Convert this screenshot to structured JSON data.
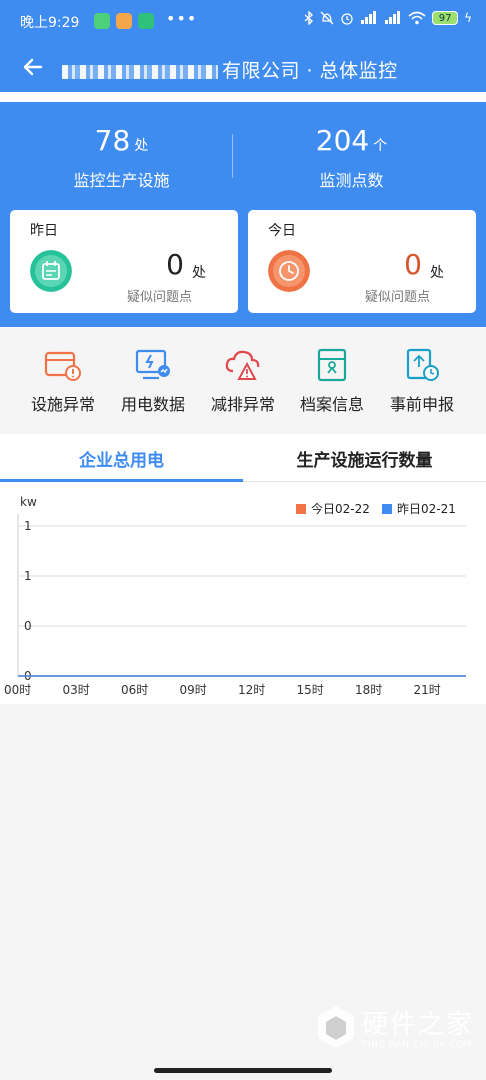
{
  "status_bar": {
    "time": "晚上9:29",
    "battery": "97"
  },
  "nav": {
    "title_blurred": "",
    "title_suffix": "有限公司 · 总体监控"
  },
  "summary": {
    "facilities": {
      "value": "78",
      "unit": "处",
      "label": "监控生产设施"
    },
    "points": {
      "value": "204",
      "unit": "个",
      "label": "监测点数"
    }
  },
  "yesterday": {
    "title": "昨日",
    "value": "0",
    "unit": "处",
    "label": "疑似问题点"
  },
  "today": {
    "title": "今日",
    "value": "0",
    "unit": "处",
    "label": "疑似问题点"
  },
  "quick_actions": [
    {
      "label": "设施异常",
      "icon": "facility-alert-icon"
    },
    {
      "label": "用电数据",
      "icon": "power-monitor-icon"
    },
    {
      "label": "减排异常",
      "icon": "cloud-alert-icon"
    },
    {
      "label": "档案信息",
      "icon": "archive-icon"
    },
    {
      "label": "事前申报",
      "icon": "report-clock-icon"
    }
  ],
  "tabs": [
    {
      "label": "企业总用电"
    },
    {
      "label": "生产设施运行数量"
    }
  ],
  "colors": {
    "primary": "#3f8cf0",
    "today": "#f07346",
    "yesterday": "#3f8cf0",
    "green": "#27c29a"
  },
  "chart_data": {
    "type": "line",
    "ylabel": "kw",
    "yticks": [
      "1",
      "1",
      "0",
      "0"
    ],
    "categories": [
      "00时",
      "03时",
      "06时",
      "09时",
      "12时",
      "15时",
      "18时",
      "21时"
    ],
    "series": [
      {
        "name": "今日02-22",
        "color": "#f07346",
        "values": [
          0,
          0,
          0,
          0,
          0,
          0,
          0,
          0
        ]
      },
      {
        "name": "昨日02-21",
        "color": "#3f8cf0",
        "values": [
          0,
          0,
          0,
          0,
          0,
          0,
          0,
          0
        ]
      }
    ]
  },
  "watermark": {
    "title": "硬件之家",
    "subtitle": "YING JIAN ZHI JIA.COM"
  }
}
